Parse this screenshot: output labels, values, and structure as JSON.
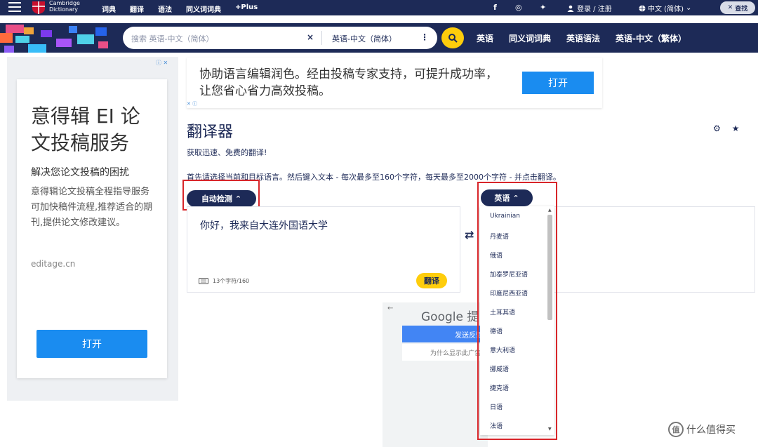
{
  "topbar": {
    "brand_line1": "Cambridge",
    "brand_line2": "Dictionary",
    "nav": [
      "词典",
      "翻译",
      "语法",
      "同义词词典",
      "+Plus"
    ],
    "social": [
      "f",
      "◎",
      "✦"
    ],
    "login": "登录 / 注册",
    "language": "中文 (简体)",
    "search_button": "查找"
  },
  "searchbar": {
    "placeholder": "搜索 英语-中文（简体）",
    "clear": "×",
    "dictionary": "英语-中文（简体）",
    "more": "⋮",
    "links": [
      "英语",
      "同义词词典",
      "英语语法",
      "英语-中文（繁体）"
    ]
  },
  "left_ad": {
    "adchoice": "ⓘ ✕",
    "title": "意得辑 EI 论文投稿服务",
    "subtitle": "解决您论文投稿的困扰",
    "body": "意得辑论文投稿全程指导服务可加快稿件流程,推荐适合的期刊,提供论文修改建议。",
    "domain": "editage.cn",
    "button": "打开"
  },
  "banner_ad": {
    "text": "协助语言编辑润色。经由投稿专家支持，可提升成功率，让您省心省力高效投稿。",
    "button": "打开",
    "adchoice": "✕ ⓘ"
  },
  "translator": {
    "title": "翻译器",
    "subtitle": "获取迅速、免费的翻译!",
    "instructions": "首先请选择当前和目标语言。然后键入文本 - 每次最多至160个字符，每天最多至2000个字符 - 并点击翻译。",
    "source_lang": "自动检测",
    "target_lang": "英语",
    "source_text": "你好，我来自大连外国语大学",
    "char_count": "13个字符/160",
    "translate_button": "翻译",
    "swap": "⇄"
  },
  "language_dropdown": {
    "options": [
      "Ukrainian",
      "丹麦语",
      "俄语",
      "加泰罗尼亚语",
      "印度尼西亚语",
      "土耳其语",
      "德语",
      "意大利语",
      "挪威语",
      "捷克语",
      "日语",
      "法语"
    ]
  },
  "google_popup": {
    "title": "Google 提供",
    "button": "发送反馈",
    "why": "为什么显示此广告"
  },
  "watermark": {
    "logo": "值",
    "text": "什么值得买"
  },
  "colors": {
    "navy": "#1d2a57",
    "yellow": "#fecd0c",
    "ad_blue": "#1a8cf0",
    "highlight_red": "#d8262a"
  }
}
